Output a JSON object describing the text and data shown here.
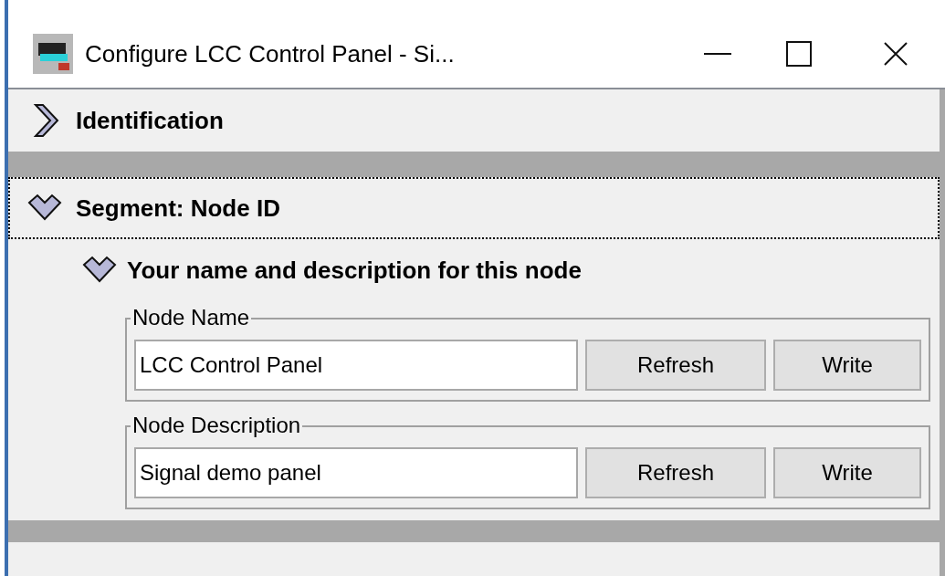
{
  "window": {
    "title": "Configure LCC Control Panel - Si..."
  },
  "sections": [
    {
      "label": "Identification",
      "expanded": false,
      "focused": false
    },
    {
      "label": "Segment: Node ID",
      "expanded": true,
      "focused": true,
      "groups": [
        {
          "label": "Your name and description for this node",
          "expanded": true,
          "fields": [
            {
              "label": "Node Name",
              "value": "LCC Control Panel",
              "buttons": [
                "Refresh",
                "Write"
              ]
            },
            {
              "label": "Node Description",
              "value": "Signal demo panel",
              "buttons": [
                "Refresh",
                "Write"
              ]
            }
          ]
        }
      ]
    }
  ]
}
